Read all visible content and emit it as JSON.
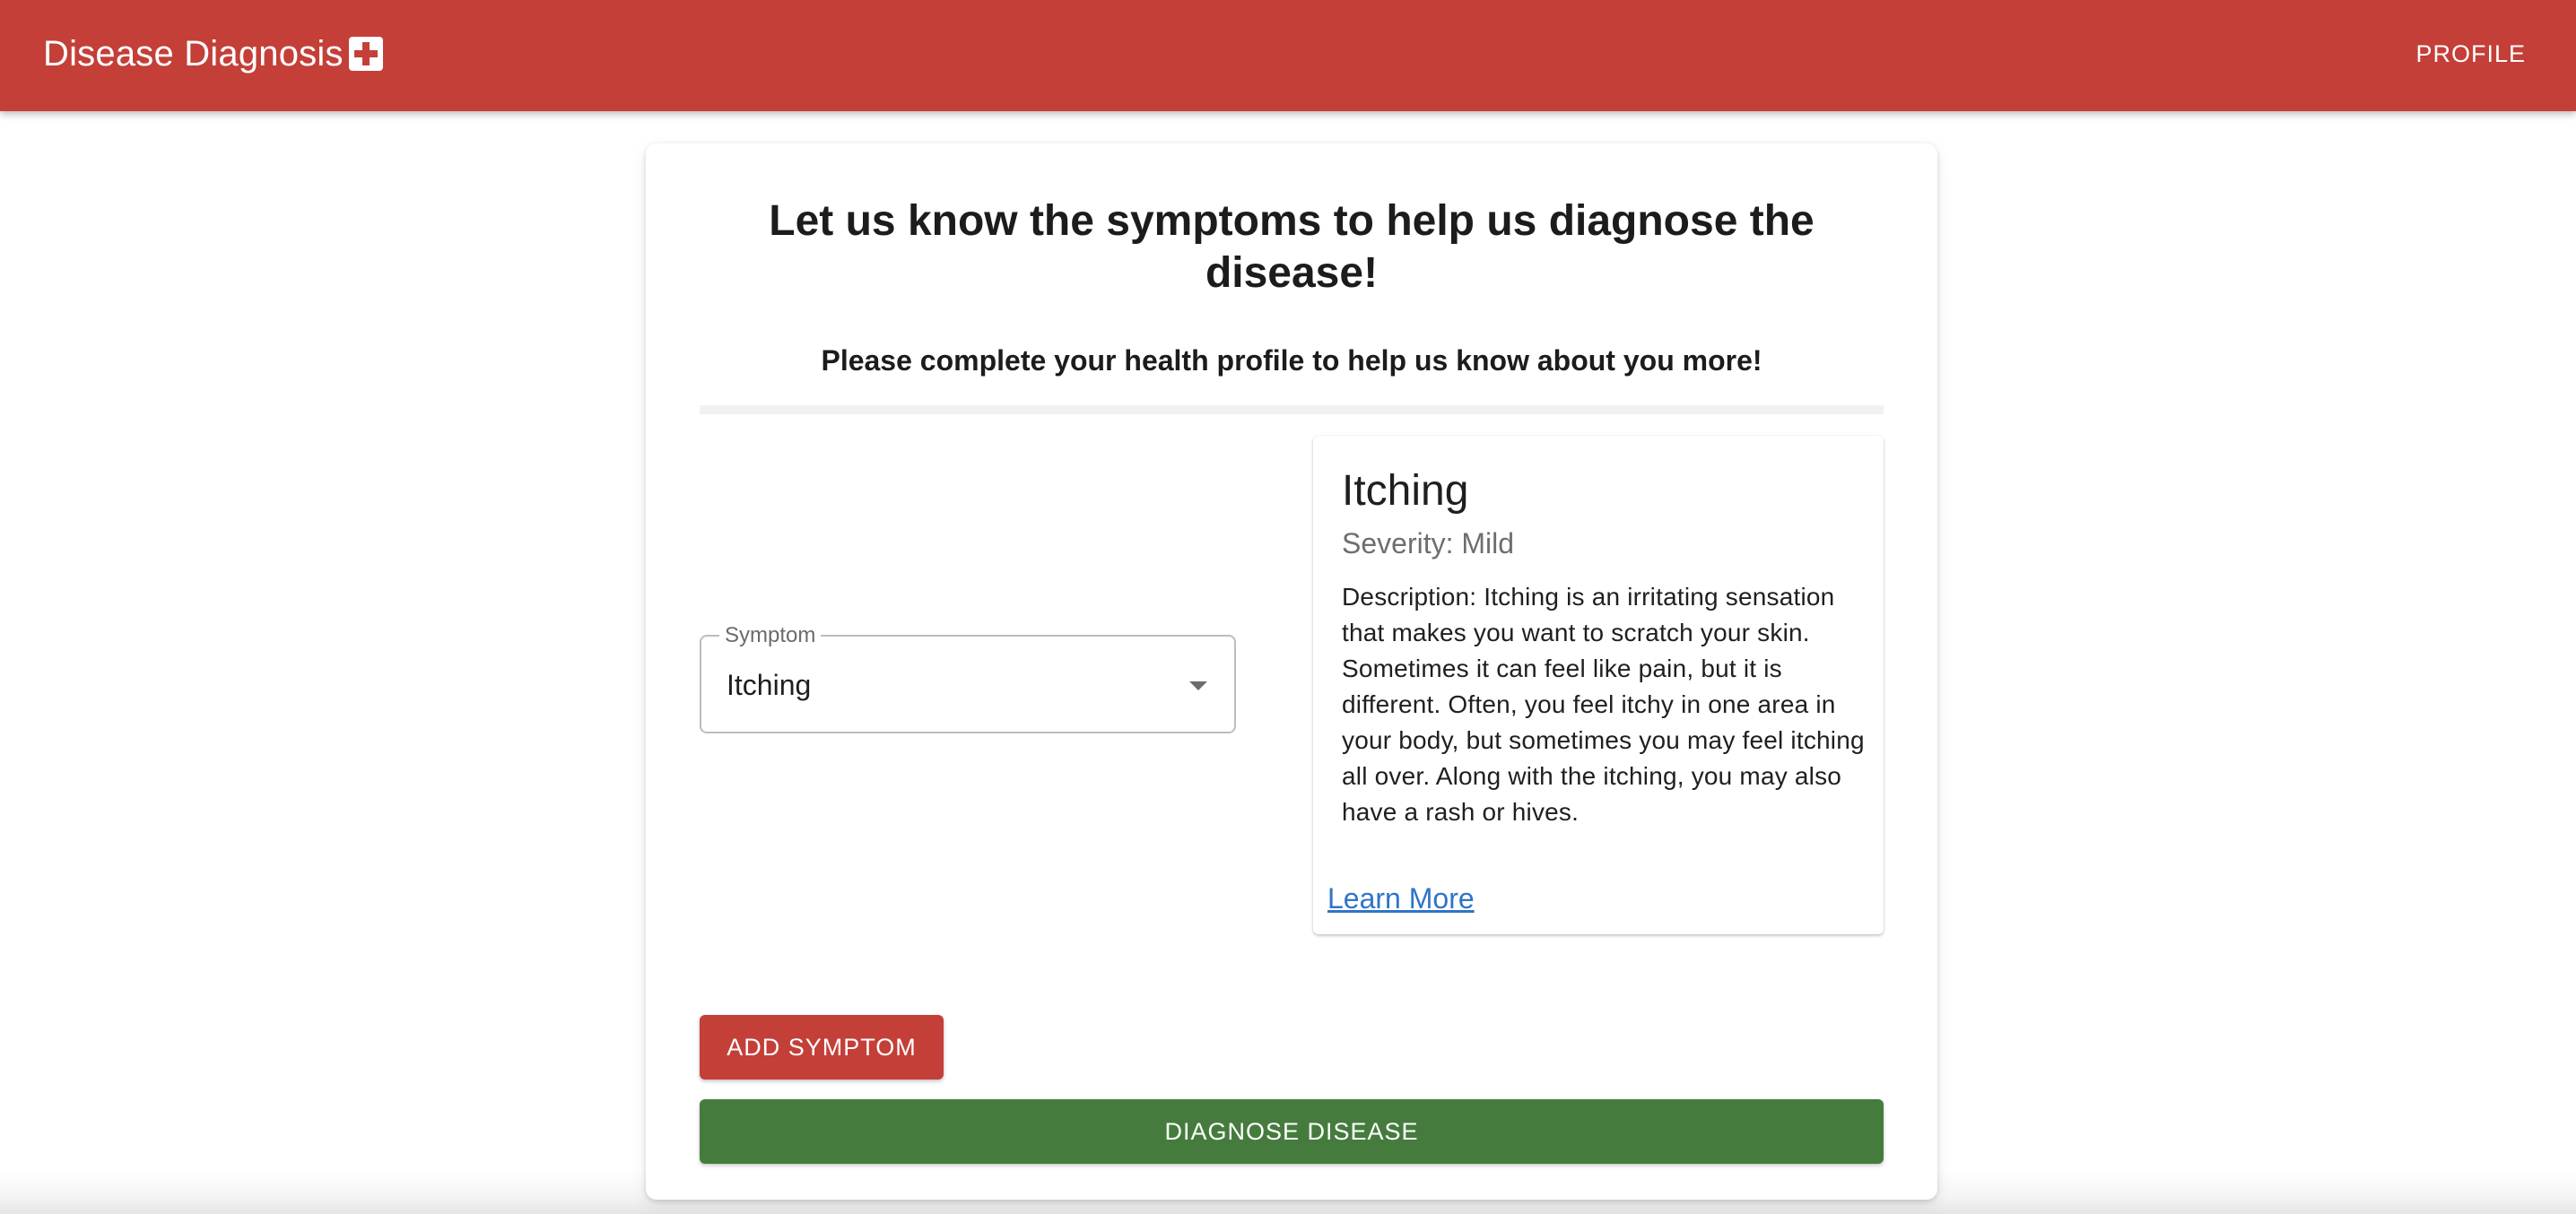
{
  "app": {
    "title": "Disease Diagnosis",
    "brand_icon": "medical-cross-icon",
    "colors": {
      "appbar": "#c43f38",
      "primary_button": "#c43f38",
      "success_button": "#457c3e",
      "link": "#2f74c8"
    }
  },
  "header": {
    "profile_label": "PROFILE"
  },
  "main": {
    "title": "Let us know the symptoms to help us diagnose the disease!",
    "subtitle": "Please complete your health profile to help us know about you more!",
    "symptom_select": {
      "label": "Symptom",
      "value": "Itching"
    },
    "symptom_card": {
      "name": "Itching",
      "severity": "Severity: Mild",
      "description": "Description: Itching is an irritating sensation that makes you want to scratch your skin. Sometimes it can feel like pain, but it is different. Often, you feel itchy in one area in your body, but sometimes you may feel itching all over. Along with the itching, you may also have a rash or hives.",
      "learn_more_label": "Learn More"
    },
    "add_symptom_label": "ADD SYMPTOM",
    "diagnose_label": "DIAGNOSE DISEASE"
  }
}
